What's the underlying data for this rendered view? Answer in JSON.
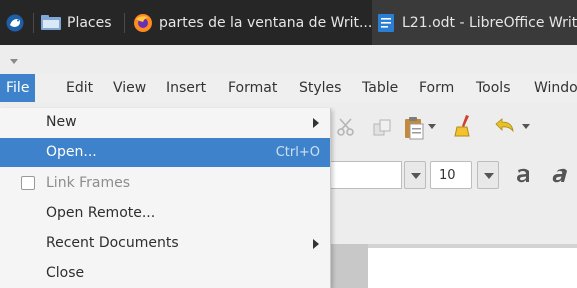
{
  "taskbar": {
    "places_label": "Places",
    "firefox_window_label": "partes de la ventana de Writ...",
    "writer_window_label": "L21.odt - LibreOffice Writ"
  },
  "menubar": {
    "items": [
      "File",
      "Edit",
      "View",
      "Insert",
      "Format",
      "Styles",
      "Table",
      "Form",
      "Tools",
      "Windo"
    ]
  },
  "file_menu": {
    "items": [
      {
        "label": "New"
      },
      {
        "label": "Open...",
        "shortcut": "Ctrl+O"
      },
      {
        "label": "Link Frames"
      },
      {
        "label": "Open Remote..."
      },
      {
        "label": "Recent Documents"
      },
      {
        "label": "Close"
      }
    ]
  },
  "toolbar": {
    "font_size": "10"
  },
  "colors": {
    "highlight": "#3d82ca",
    "taskbar": "#262626"
  }
}
